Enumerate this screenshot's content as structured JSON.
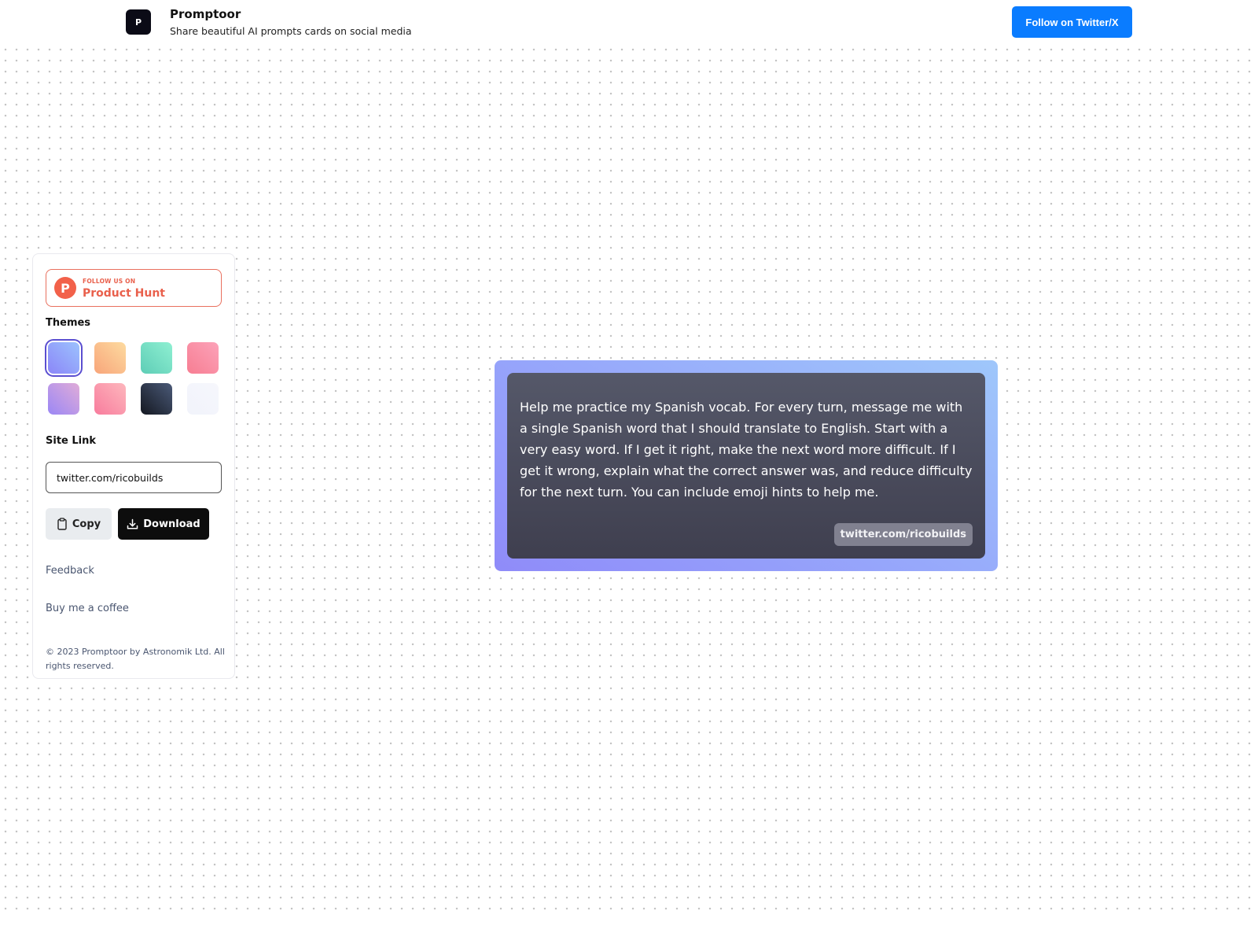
{
  "header": {
    "logo_letter": "P",
    "title": "Promptoor",
    "subtitle": "Share beautiful AI prompts cards on social media",
    "follow_button": "Follow on Twitter/X"
  },
  "sidebar": {
    "product_hunt": {
      "small_label": "FOLLOW US ON",
      "big_label": "Product Hunt",
      "icon_letter": "P"
    },
    "themes_label": "Themes",
    "themes": [
      {
        "name": "blue-violet",
        "from": "#8b86f8",
        "to": "#9cc2fd",
        "selected": true
      },
      {
        "name": "peach",
        "from": "#f8a57a",
        "to": "#fddba0",
        "selected": false
      },
      {
        "name": "teal",
        "from": "#5ecdb6",
        "to": "#8ff0d2",
        "selected": false
      },
      {
        "name": "pink-red",
        "from": "#f77d92",
        "to": "#fca3b9",
        "selected": false
      },
      {
        "name": "lavender",
        "from": "#9b87f5",
        "to": "#e0acd8",
        "selected": false
      },
      {
        "name": "pink",
        "from": "#f87c9d",
        "to": "#fdb7bd",
        "selected": false
      },
      {
        "name": "dark-slate",
        "from": "#141821",
        "to": "#4b5a78",
        "selected": false
      },
      {
        "name": "light",
        "from": "#f1f3fb",
        "to": "#f6f7fc",
        "selected": false
      }
    ],
    "site_link_label": "Site Link",
    "site_link_value": "twitter.com/ricobuilds",
    "copy_button": "Copy",
    "download_button": "Download",
    "feedback_link": "Feedback",
    "coffee_link": "Buy me a coffee",
    "copyright": "© 2023 Promptoor by Astronomik Ltd. All rights reserved."
  },
  "card": {
    "prompt_text": "Help me practice my Spanish vocab. For every turn, message me with a single Spanish word that I should translate to English. Start with a very easy word. If I get it right, make the next word more difficult. If I get it wrong, explain what the correct answer was, and reduce difficulty for the next turn. You can include emoji hints to help me.",
    "site_tag": "twitter.com/ricobuilds"
  },
  "icons": {
    "copy": "clipboard-icon",
    "download": "download-icon"
  }
}
